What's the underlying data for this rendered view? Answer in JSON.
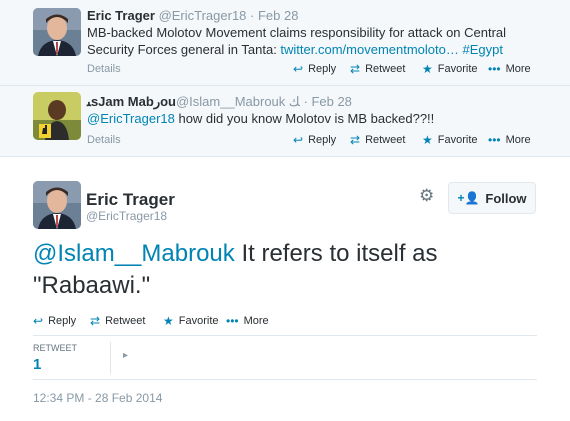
{
  "tweets": [
    {
      "name": "Eric Trager",
      "handle": "@EricTrager18",
      "time": "· Feb 28",
      "text_plain": "MB-backed Molotov Movement claims responsibility for attack on Central Security Forces general in Tanta: ",
      "link": "twitter.com/movementmoloto…",
      "hashtag": "#Egypt",
      "details": "Details"
    },
    {
      "name": "ﯩsJam Mabﺭou",
      "handle": "@Islam__Mabrouk",
      "name_suffix": "ﻚ",
      "time": "· Feb 28",
      "mention": "@EricTrager18",
      "text_plain": " how did you know Molotov is MB backed??!!",
      "details": "Details"
    }
  ],
  "actions": {
    "reply": "Reply",
    "retweet": "Retweet",
    "favorite": "Favorite",
    "more": "More"
  },
  "main_tweet": {
    "name": "Eric Trager",
    "handle": "@EricTrager18",
    "follow_label": "Follow",
    "mention": "@Islam__Mabrouk",
    "text": " It refers to itself as \"Rabaawi.\"",
    "retweets_label": "RETWEET",
    "retweets_count": "1",
    "timestamp": "12:34 PM - 28 Feb 2014"
  },
  "colors": {
    "link": "#0084b4",
    "muted": "#8899a6",
    "panel_bg": "#f5f8fa"
  }
}
